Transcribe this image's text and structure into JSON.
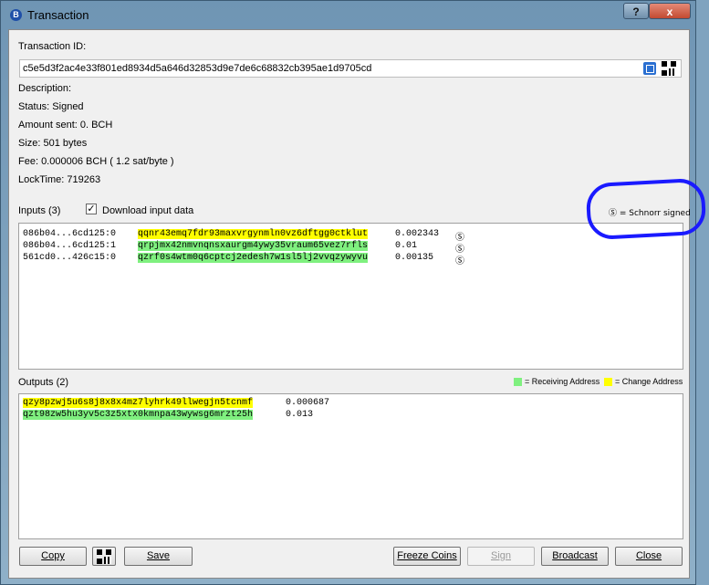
{
  "window": {
    "title": "Transaction",
    "help_label": "?",
    "close_label": "x"
  },
  "details": {
    "txid_label": "Transaction ID:",
    "txid": "c5e5d3f2ac4e33f801ed8934d5a646d32853d9e7de6c68832cb395ae1d9705cd",
    "description": "Description:",
    "status": "Status: Signed",
    "amount": "Amount sent: 0. BCH",
    "size": "Size: 501 bytes",
    "fee": "Fee: 0.000006 BCH ( 1.2 sat/byte )",
    "locktime": "LockTime: 719263"
  },
  "inputs": {
    "label": "Inputs (3)",
    "download_label": "Download input data",
    "download_checked": "✓",
    "schnorr_legend": "Ⓢ = Schnorr signed",
    "rows": [
      {
        "prevout": "086b04...6cd125:0",
        "address": "qqnr43emq7fdr93maxvrgynmln0vz6dftgg0ctklut",
        "amount": "0.002343",
        "sig": "Ⓢ"
      },
      {
        "prevout": "086b04...6cd125:1",
        "address": "qrpjmx42nmvnqnsxaurgm4ywy35vraum65vez7rfls",
        "amount": "0.01",
        "sig": "Ⓢ"
      },
      {
        "prevout": "561cd0...426c15:0",
        "address": "qzrf0s4wtm0q6cptcj2edesh7w1sl5lj2vvqzywyvu",
        "amount": "0.00135",
        "sig": "Ⓢ"
      }
    ]
  },
  "outputs": {
    "label": "Outputs (2)",
    "receiving_legend": "= Receiving Address",
    "change_legend": "= Change Address",
    "rows": [
      {
        "address": "qzy8pzwj5u6s8j8x8x4mz7lyhrk49llwegjn5tcnmf",
        "amount": "0.000687"
      },
      {
        "address": "qzt98zw5hu3yv5c3z5xtx0kmnpa43wywsg6mrzt25h",
        "amount": "0.013"
      }
    ]
  },
  "buttons": {
    "copy": "Copy",
    "save": "Save",
    "freeze": "Freeze Coins",
    "sign": "Sign",
    "broadcast": "Broadcast",
    "close": "Close"
  },
  "colors": {
    "change": "#ffff00",
    "receiving": "#7ff07f",
    "annotation": "#1a1aff"
  }
}
